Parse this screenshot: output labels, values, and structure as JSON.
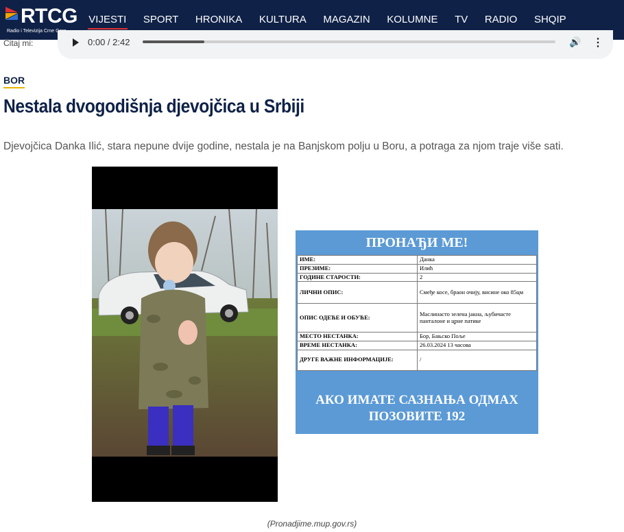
{
  "brand": {
    "name": "RTCG",
    "subtitle": "Radio i Televizija Crne Gore"
  },
  "nav": {
    "items": [
      {
        "label": "VIJESTI",
        "active": true
      },
      {
        "label": "SPORT"
      },
      {
        "label": "HRONIKA"
      },
      {
        "label": "KULTURA"
      },
      {
        "label": "MAGAZIN"
      },
      {
        "label": "KOLUMNE"
      },
      {
        "label": "TV"
      },
      {
        "label": "RADIO"
      },
      {
        "label": "SHQIP"
      }
    ]
  },
  "audio": {
    "label": "Čitaj mi:",
    "time": "0:00 / 2:42",
    "progress_fraction": 0.15
  },
  "article": {
    "category": "BOR",
    "headline": "Nestala dvogodišnja djevojčica u Srbiji",
    "lead": "Djevojčica Danka Ilić, stara nepune dvije godine, nestala je na Banjskom polju u Boru, a potraga za njom traje više sati.",
    "caption": "(Pronadjime.mup.gov.rs)"
  },
  "poster": {
    "title": "ПРОНАЂИ МЕ!",
    "rows": [
      {
        "k": "ИМЕ:",
        "v": "Данка"
      },
      {
        "k": "ПРЕЗИМЕ:",
        "v": "Илић"
      },
      {
        "k": "ГОДИНЕ СТАРОСТИ:",
        "v": "2"
      },
      {
        "k": "ЛИЧНИ ОПИС:",
        "v": "Смеђе косе, браон очију, висине око 85цм"
      },
      {
        "k": "ОПИС ОДЕЋЕ И ОБУЋЕ:",
        "v": "Маслинасто зелена јакна, љубичасте панталоне и црне патике"
      },
      {
        "k": "МЕСТО НЕСТАНКА:",
        "v": "Бор, Бањско Поље"
      },
      {
        "k": "ВРЕМЕ НЕСТАНКА:",
        "v": "26.03.2024 13 часова"
      },
      {
        "k": "ДРУГЕ ВАЖНЕ ИНФОРМАЦИЈЕ:",
        "v": "/"
      }
    ],
    "footer_line1": "АКО ИМАТЕ САЗНАЊА ОДМАХ",
    "footer_line2": "ПОЗОВИТЕ 192"
  },
  "colors": {
    "navbar": "#0f2147",
    "accent_red": "#e03131",
    "category_underline": "#e8b400",
    "poster_blue": "#5b9ad5"
  }
}
